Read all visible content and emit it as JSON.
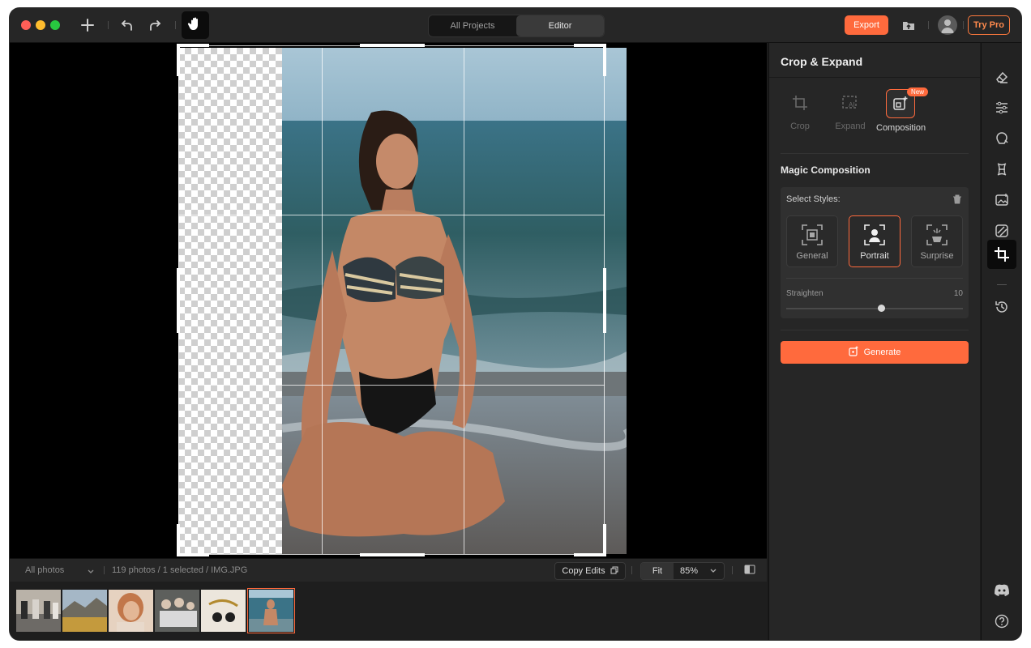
{
  "topbar": {
    "tabs": [
      {
        "label": "All Projects",
        "active": false
      },
      {
        "label": "Editor",
        "active": true
      }
    ],
    "export_label": "Export",
    "trypro_label": "Try Pro",
    "icons": [
      "plus-icon",
      "undo-icon",
      "redo-icon",
      "hand-icon",
      "import-icon",
      "avatar-icon"
    ]
  },
  "panel": {
    "title": "Crop & Expand",
    "modes": [
      {
        "label": "Crop",
        "icon": "crop-icon",
        "enabled": false
      },
      {
        "label": "Expand",
        "icon": "ai-expand-icon",
        "enabled": false
      },
      {
        "label": "Composition",
        "icon": "composition-icon",
        "enabled": true,
        "badge": "New"
      }
    ],
    "section_title": "Magic Composition",
    "styles_label": "Select Styles:",
    "styles": [
      {
        "label": "General",
        "icon": "general-style-icon",
        "selected": false
      },
      {
        "label": "Portrait",
        "icon": "portrait-style-icon",
        "selected": true
      },
      {
        "label": "Surprise",
        "icon": "surprise-style-icon",
        "selected": false
      }
    ],
    "straighten_label": "Straighten",
    "straighten_value": "10",
    "generate_label": "Generate"
  },
  "bottombar": {
    "filter_label": "All photos",
    "status": "119 photos / 1 selected / IMG.JPG",
    "copy_edits_label": "Copy Edits",
    "fit_label": "Fit",
    "zoom": "85%"
  },
  "filmstrip": {
    "thumbnails": [
      "group-photo",
      "landscape-hills",
      "portrait-woman",
      "family-photo",
      "still-life-sunglasses",
      "beach-woman"
    ],
    "selected_index": 5
  },
  "rail": {
    "tools": [
      "eraser-icon",
      "adjust-sliders-icon",
      "face-retouch-icon",
      "body-icon",
      "image-enhance-icon",
      "remove-object-icon",
      "crop-expand-icon",
      "history-icon",
      "discord-icon",
      "help-icon"
    ],
    "active_tool": "crop-expand-icon"
  },
  "colors": {
    "accent": "#ff6a3d",
    "background": "#1c1c1c",
    "panel": "#262626"
  }
}
